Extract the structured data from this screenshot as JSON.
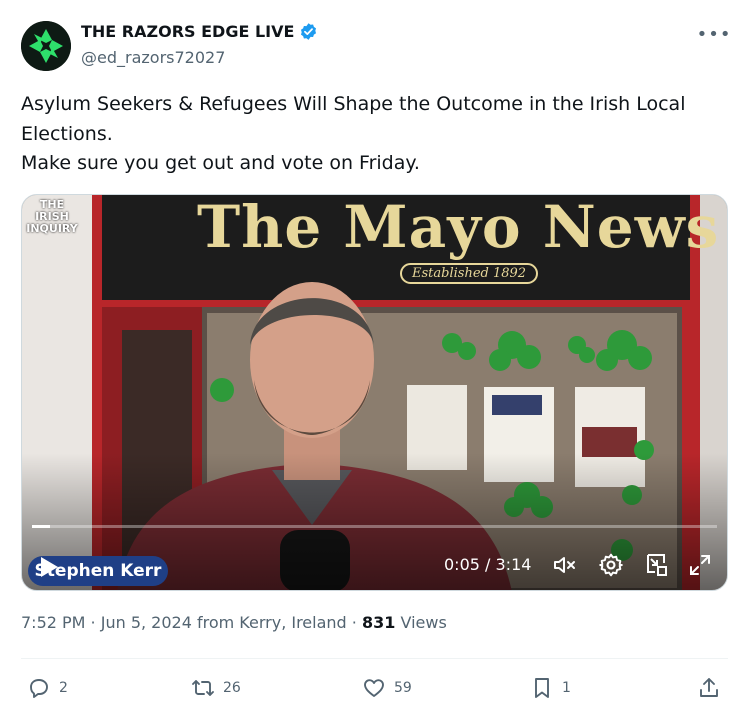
{
  "author": {
    "name": "THE RAZORS EDGE LIVE",
    "handle": "@ed_razors72027"
  },
  "more_label": "•••",
  "tweet": {
    "lines": [
      "Asylum Seekers & Refugees Will Shape the Outcome in the Irish Local",
      "Elections.",
      "Make sure you get out and vote on Friday."
    ]
  },
  "video": {
    "watermark": [
      "THE",
      "IRISH",
      "INQUIRY"
    ],
    "sign_title": "The Mayo News",
    "sign_established": "Established 1892",
    "speaker_tag": "Stephen Kerr",
    "time": "0:05 / 3:14",
    "progress": 0.026
  },
  "meta": {
    "time": "7:52 PM",
    "date": "Jun 5, 2024",
    "location": "from Kerry, Ireland",
    "views_count": "831",
    "views_label": "Views"
  },
  "actions": {
    "replies": "2",
    "reposts": "26",
    "likes": "59",
    "bookmarks": "1"
  },
  "colors": {
    "accent": "#1d9bf0",
    "muted": "#536471",
    "sign_red": "#b8262a"
  }
}
